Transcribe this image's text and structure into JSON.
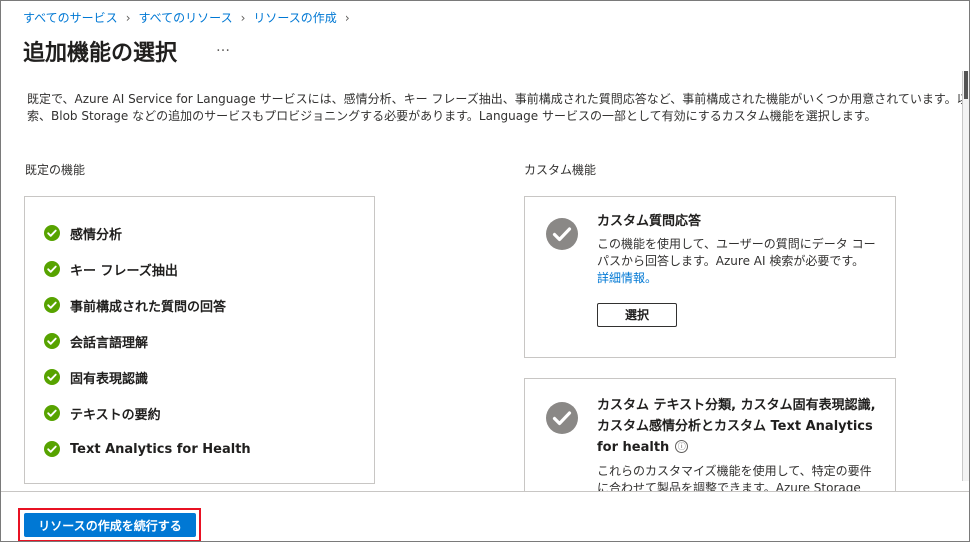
{
  "breadcrumb": [
    {
      "label": "すべてのサービス"
    },
    {
      "label": "すべてのリソース"
    },
    {
      "label": "リソースの作成"
    }
  ],
  "page": {
    "title": "追加機能の選択",
    "more_label": "…"
  },
  "description": {
    "line1": "既定で、Azure AI Service for Language サービスには、感情分析、キー フレーズ抽出、事前構成された質問応答など、事前構成された機能がいくつか用意されています。以下のカスタマイ",
    "line2": "索、Blob Storage などの追加のサービスもプロビジョニングする必要があります。Language サービスの一部として有効にするカスタム機能を選択します。"
  },
  "default_section": {
    "label": "既定の機能",
    "features": [
      {
        "label": "感情分析"
      },
      {
        "label": "キー フレーズ抽出"
      },
      {
        "label": "事前構成された質問の回答"
      },
      {
        "label": "会話言語理解"
      },
      {
        "label": "固有表現認識"
      },
      {
        "label": "テキストの要約"
      },
      {
        "label": "Text Analytics for Health"
      }
    ]
  },
  "custom_section": {
    "label": "カスタム機能",
    "cards": [
      {
        "title": "カスタム質問応答",
        "text": "この機能を使用して、ユーザーの質問にデータ コーパスから回答します。Azure AI 検索が必要です。",
        "link": "詳細情報。",
        "button": "選択"
      },
      {
        "title": "カスタム テキスト分類, カスタム固有表現認識, カスタム感情分析とカスタム Text Analytics for health",
        "info_icon": "ⓘ",
        "text": "これらのカスタマイズ機能を使用して、特定の要件に合わせて製品を調整できます。Azure Storage"
      }
    ]
  },
  "footer": {
    "primary_button": "リソースの作成を続行する"
  },
  "colors": {
    "accent": "#0078d4",
    "check_green": "#57a300",
    "highlight_red": "#e81123",
    "check_gray": "#8a8886"
  }
}
